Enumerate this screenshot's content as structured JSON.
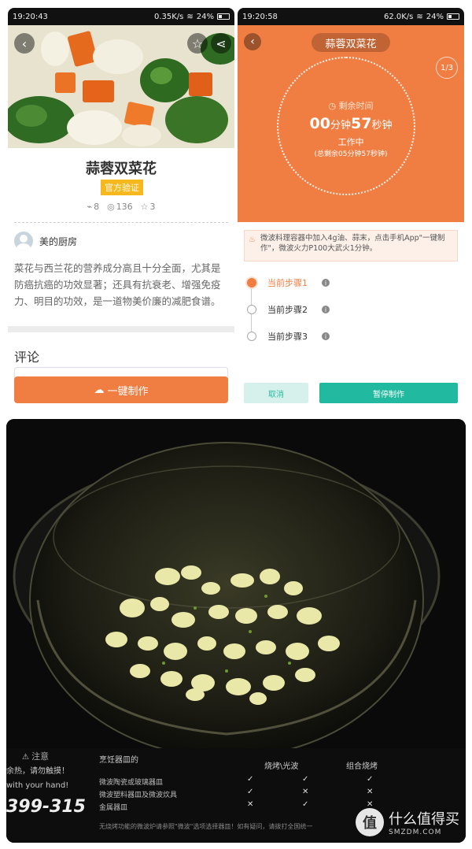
{
  "left_screen": {
    "status": {
      "time": "19:20:43",
      "net": "0.35K/s",
      "battery": "24%"
    },
    "recipe_title": "蒜蓉双菜花",
    "verify_badge": "官方验证",
    "stats": {
      "saves": "8",
      "views": "136",
      "likes": "3"
    },
    "author": "美的厨房",
    "description": "菜花与西兰花的营养成分高且十分全面，尤其是防癌抗癌的功效显著；还具有抗衰老、增强免疫力、明目的功效，是一道物美价廉的减肥食谱。",
    "comment_heading": "评论",
    "oneclick_label": "一键制作"
  },
  "right_screen": {
    "status": {
      "time": "19:20:58",
      "net": "62.0K/s",
      "battery": "24%"
    },
    "title": "蒜蓉双菜花",
    "page_num": "1",
    "page_total": "3",
    "remaining_label": "剩余时间",
    "timer": {
      "min": "00",
      "min_unit": "分钟",
      "sec": "57",
      "sec_unit": "秒钟"
    },
    "working": "工作中",
    "total_remaining": "(总剩余05分钟57秒钟)",
    "instruction": "微波料理容器中加入4g油、蒜末，点击手机App\"一键制作\"，微波火力P100大武火1分钟。",
    "steps": [
      {
        "label": "当前步骤1"
      },
      {
        "label": "当前步骤2"
      },
      {
        "label": "当前步骤3"
      }
    ],
    "cancel_label": "取消",
    "pause_label": "暂停制作"
  },
  "photo": {
    "caution_title": "注意",
    "caution_line1": "余热，请勿触摸！",
    "caution_line2": "with your hand!",
    "hotline": "399-315",
    "table_title": "烹饪器皿的",
    "col_grill": "烧烤\\光波",
    "col_combo": "组合烧烤",
    "rows": [
      "微波陶瓷或玻璃器皿",
      "微波塑料器皿及微波炊具",
      "金属器皿"
    ],
    "footnote": "无烧烤功能的微波炉请参照\"微波\"选项选择器皿！如有疑问，请拨打全国统一",
    "watermark_cn": "什么值得买",
    "watermark_en": "SMZDM.COM",
    "watermark_logo": "值"
  },
  "colors": {
    "orange": "#f07e43",
    "teal": "#21b99f",
    "gold": "#f6b81d"
  }
}
